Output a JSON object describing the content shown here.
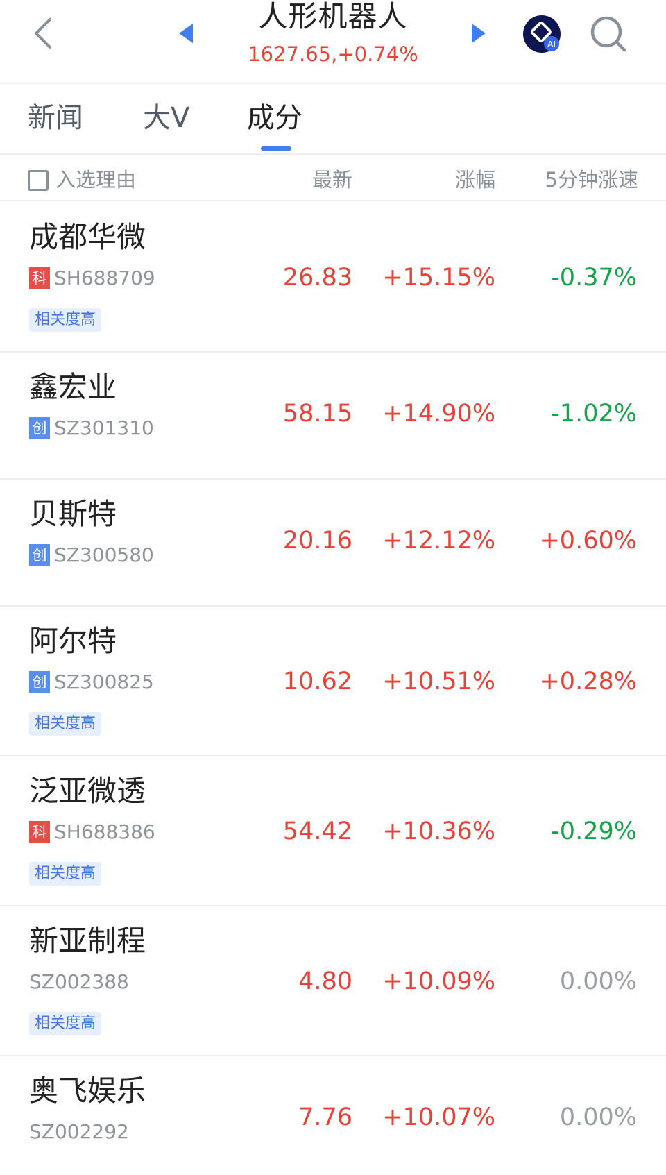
{
  "header": {
    "title": "人形机器人",
    "subtitle": "1627.65,+0.74%",
    "ai_label": "AI"
  },
  "tabs": [
    {
      "label": "新闻",
      "active": false
    },
    {
      "label": "大V",
      "active": false
    },
    {
      "label": "成分",
      "active": true
    }
  ],
  "columns": {
    "reason": "入选理由",
    "latest": "最新",
    "change": "涨幅",
    "speed": "5分钟涨速"
  },
  "rows": [
    {
      "name": "成都华微",
      "badge": "科",
      "code": "SH688709",
      "tag": "相关度高",
      "latest": "26.83",
      "change": "+15.15%",
      "speed": "-0.37%"
    },
    {
      "name": "鑫宏业",
      "badge": "创",
      "code": "SZ301310",
      "tag": "",
      "latest": "58.15",
      "change": "+14.90%",
      "speed": "-1.02%"
    },
    {
      "name": "贝斯特",
      "badge": "创",
      "code": "SZ300580",
      "tag": "",
      "latest": "20.16",
      "change": "+12.12%",
      "speed": "+0.60%"
    },
    {
      "name": "阿尔特",
      "badge": "创",
      "code": "SZ300825",
      "tag": "相关度高",
      "latest": "10.62",
      "change": "+10.51%",
      "speed": "+0.28%"
    },
    {
      "name": "泛亚微透",
      "badge": "科",
      "code": "SH688386",
      "tag": "相关度高",
      "latest": "54.42",
      "change": "+10.36%",
      "speed": "-0.29%"
    },
    {
      "name": "新亚制程",
      "badge": "",
      "code": "SZ002388",
      "tag": "相关度高",
      "latest": "4.80",
      "change": "+10.09%",
      "speed": "0.00%"
    },
    {
      "name": "奥飞娱乐",
      "badge": "",
      "code": "SZ002292",
      "tag": "",
      "latest": "7.76",
      "change": "+10.07%",
      "speed": "0.00%"
    }
  ],
  "colors": {
    "up": "#ea4137",
    "down": "#17a34a",
    "flat": "#9a9ea5",
    "accent": "#3f7ef0"
  },
  "icons": [
    "back-arrow-icon",
    "prev-triangle-icon",
    "next-triangle-icon",
    "ai-assistant-icon",
    "search-icon"
  ]
}
